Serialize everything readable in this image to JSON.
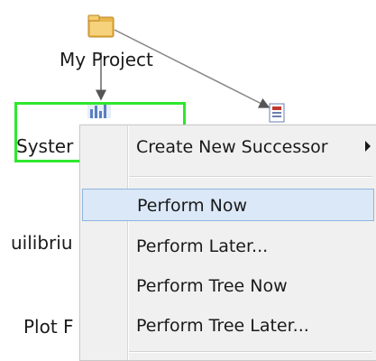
{
  "nodes": {
    "root_label": "My Project",
    "child1_label": "Syster",
    "child2_label": "uilibriu",
    "child3_label": "Plot F"
  },
  "menu": {
    "items": [
      {
        "label": "Create New Successor",
        "has_submenu": true
      },
      {
        "label": "Perform Now",
        "highlighted": true
      },
      {
        "label": "Perform Later..."
      },
      {
        "label": "Perform Tree Now"
      },
      {
        "label": "Perform Tree Later..."
      }
    ]
  },
  "colors": {
    "selection_border": "#2ee82e",
    "menu_highlight": "#dbe8f7",
    "folder_icon": "#e8b54a"
  }
}
